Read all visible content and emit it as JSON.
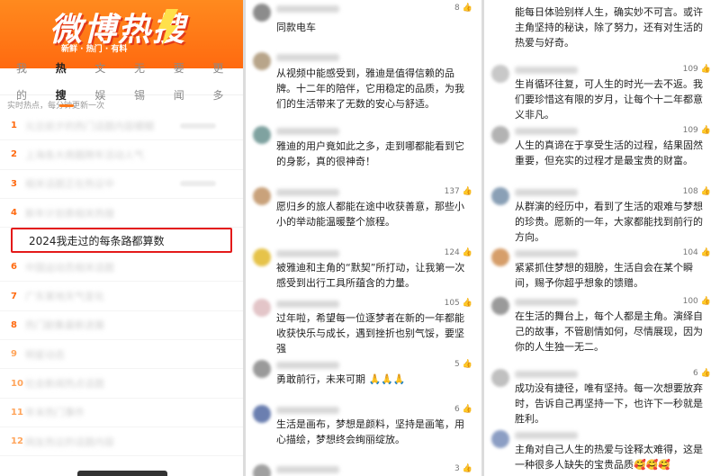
{
  "banner": {
    "title": "微博热搜",
    "subtitle": "新鲜 · 热门 · 有料"
  },
  "tabs": [
    "我的",
    "热搜",
    "文娱",
    "无锡",
    "要闻",
    "更多"
  ],
  "notice": "实时热点，每分钟更新一次",
  "hot_list": {
    "highlight_text": "2024我走过的每条路都算数",
    "items": [
      {
        "rank": "1",
        "text": "元旦前夕的热门话题内容模糊"
      },
      {
        "rank": "2",
        "text": "上海各大商圈跨年活动人气"
      },
      {
        "rank": "3",
        "text": "相关话题正在热议中"
      },
      {
        "rank": "4",
        "text": "新年计划表相关热搜"
      },
      {
        "rank": "5",
        "text": "2024我走过的每条路都算数"
      },
      {
        "rank": "6",
        "text": "中国运动员相关话题"
      },
      {
        "rank": "7",
        "text": "广东某地天气变化"
      },
      {
        "rank": "8",
        "text": "热门剧集最新进展"
      },
      {
        "rank": "9",
        "text": "明星动态"
      },
      {
        "rank": "10",
        "text": "社会新闻热点话题"
      },
      {
        "rank": "11",
        "text": "年末热门事件"
      },
      {
        "rank": "12",
        "text": "网友热议的话题内容"
      }
    ]
  },
  "comments_left": [
    {
      "likes": "8",
      "text": "同款电车",
      "avatar_color": "#8c8c8c"
    },
    {
      "likes": "",
      "text": "从视频中能感受到，雅迪是值得信赖的品牌。十二年的陪伴，它用稳定的品质，为我们的生活带来了无数的安心与舒适。",
      "avatar_color": "#b8a58a"
    },
    {
      "likes": "",
      "text": "雅迪的用户竟如此之多，走到哪都能看到它的身影，真的很神奇！",
      "avatar_color": "#7fa2a0"
    },
    {
      "likes": "137",
      "text": "愿归乡的旅人都能在途中收获善意，那些小小的举动能温暖整个旅程。",
      "avatar_color": "#c9a27b"
    },
    {
      "likes": "124",
      "text": "被雅迪和主角的“默契”所打动，让我第一次感受到出行工具所蕴含的力量。",
      "avatar_color": "#e6c34a"
    },
    {
      "likes": "105",
      "text": "过年啦，希望每一位逐梦者在新的一年都能收获快乐与成长，遇到挫折也别气馁，要坚强",
      "avatar_color": "#e3c5c8"
    },
    {
      "likes": "5",
      "text": "勇敢前行，未来可期 🙏🙏🙏",
      "avatar_color": "#9a9a9a"
    },
    {
      "likes": "6",
      "text": "生活是画布，梦想是颜料，坚持是画笔，用心描绘，梦想终会绚丽绽放。",
      "avatar_color": "#6b7fb0"
    },
    {
      "likes": "3",
      "text": "",
      "avatar_color": "#a0a0a0"
    }
  ],
  "comments_right": [
    {
      "likes": "",
      "text": "能每日体验别样人生，确实妙不可言。或许主角坚持的秘诀，除了努力，还有对生活的热爱与好奇。",
      "avatar_color": "#a0a0a0"
    },
    {
      "likes": "109",
      "text": "生肖循环往复，可人生的时光一去不返。我们要珍惜这有限的岁月，让每个十二年都意义非凡。",
      "avatar_color": "#c8c8c8"
    },
    {
      "likes": "109",
      "text": "人生的真谛在于享受生活的过程，结果固然重要，但充实的过程才是最宝贵的财富。",
      "avatar_color": "#b3b3b3"
    },
    {
      "likes": "108",
      "text": "从群演的经历中，看到了生活的艰难与梦想的珍贵。愿新的一年，大家都能找到前行的方向。",
      "avatar_color": "#8aa0b6"
    },
    {
      "likes": "104",
      "text": "紧紧抓住梦想的翅膀，生活自会在某个瞬间，赐予你超乎想象的馈赠。",
      "avatar_color": "#d69e6a"
    },
    {
      "likes": "100",
      "text": "在生活的舞台上，每个人都是主角。演绎自己的故事，不管剧情如何，尽情展现，因为你的人生独一无二。",
      "avatar_color": "#9a9a9a"
    },
    {
      "likes": "6",
      "text": "成功没有捷径，唯有坚持。每一次想要放弃时，告诉自己再坚持一下，也许下一秒就是胜利。",
      "avatar_color": "#c0c0c0"
    },
    {
      "likes": "",
      "text": "主角对自己人生的热爱与诠释太难得，这是一种很多人缺失的宝贵品质🥰🥰🥰",
      "avatar_color": "#8c9ec4"
    }
  ]
}
